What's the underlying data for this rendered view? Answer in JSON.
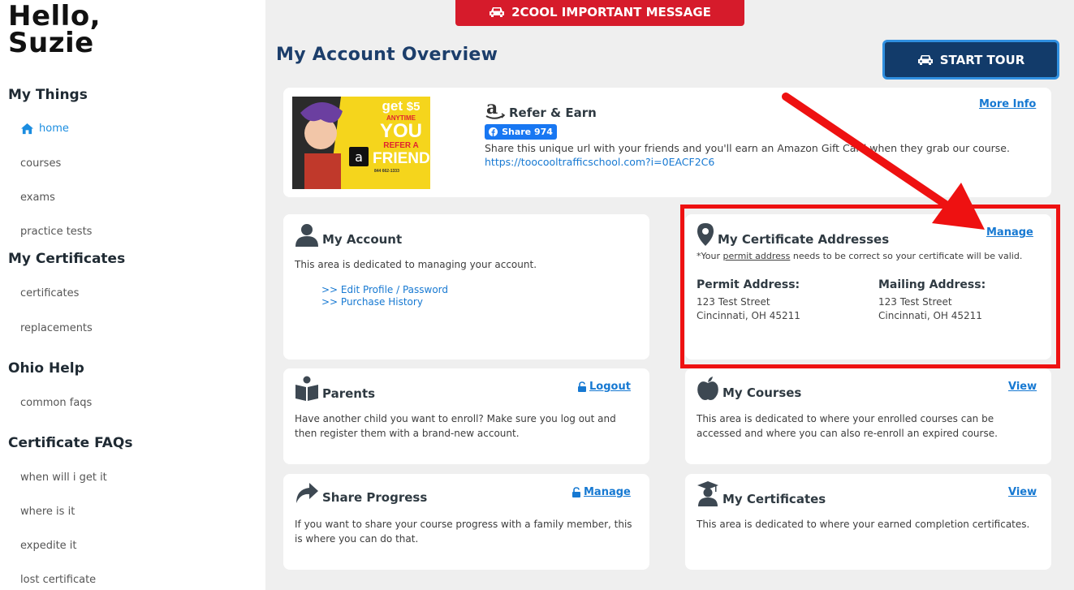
{
  "sidebar": {
    "greeting_line1": "Hello,",
    "greeting_line2": "Suzie",
    "sections": [
      {
        "title": "My Things",
        "items": [
          "home",
          "courses",
          "exams",
          "practice tests"
        ]
      },
      {
        "title": "My Certificates",
        "items": [
          "certificates",
          "replacements"
        ]
      },
      {
        "title": "Ohio Help",
        "items": [
          "common faqs"
        ]
      },
      {
        "title": "Certificate FAQs",
        "items": [
          "when will i get it",
          "where is it",
          "expedite it",
          "lost certificate"
        ]
      }
    ],
    "active_item": "home"
  },
  "header": {
    "message_button": "2COOL IMPORTANT MESSAGE",
    "page_title": "My Account Overview",
    "tour_button": "START TOUR"
  },
  "refer": {
    "title": "Refer & Earn",
    "more_info": "More Info",
    "share_label": "Share 974",
    "description": "Share this unique url with your friends and you'll earn an Amazon Gift Card when they grab our course.",
    "url": "https://toocooltrafficschool.com?i=0EACF2C6",
    "promo": {
      "get": "get",
      "amount": "$5",
      "anytime": "ANYTIME",
      "you": "YOU",
      "refer": "REFER A",
      "friend": "FRIEND",
      "phone": "844 662-1333"
    }
  },
  "account": {
    "title": "My Account",
    "description": "This area is dedicated to managing your account.",
    "links": [
      ">> Edit Profile / Password",
      ">> Purchase History"
    ]
  },
  "addresses": {
    "title": "My Certificate Addresses",
    "manage": "Manage",
    "note_prefix": "*Your ",
    "note_link": "permit address",
    "note_suffix": " needs to be correct so your certificate will be valid.",
    "permit": {
      "label": "Permit Address:",
      "line1": "123 Test Street",
      "line2": "Cincinnati, OH 45211"
    },
    "mailing": {
      "label": "Mailing Address:",
      "line1": "123 Test Street",
      "line2": "Cincinnati, OH 45211"
    }
  },
  "parents": {
    "title": "Parents",
    "action": "Logout",
    "description": "Have another child you want to enroll? Make sure you log out and then register them with a brand-new account."
  },
  "courses": {
    "title": "My Courses",
    "action": "View",
    "description": "This area is dedicated to where your enrolled courses can be accessed and where you can also re-enroll an expired course."
  },
  "share_progress": {
    "title": "Share Progress",
    "action": "Manage",
    "description": "If you want to share your course progress with a family member, this is where you can do that."
  },
  "certificates": {
    "title": "My Certificates",
    "action": "View",
    "description": "This area is dedicated to where your earned completion certificates."
  },
  "colors": {
    "accent": "#1c3e6b",
    "alert": "#d61b2b",
    "link": "#1779d2",
    "highlight": "#ee1111"
  }
}
